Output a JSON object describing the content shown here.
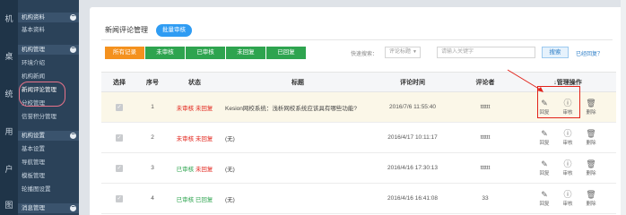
{
  "rail_icons": [
    "机",
    "桌",
    "统",
    "用",
    "户",
    "图"
  ],
  "menu": {
    "sections": [
      {
        "label": "机构资料",
        "items": [
          "基本资料"
        ]
      },
      {
        "label": "机构管理",
        "items": [
          "环境介绍",
          "机构新闻",
          "新闻评论管理",
          "分校管理",
          "信誉积分管理"
        ]
      },
      {
        "label": "机构设置",
        "items": [
          "基本设置",
          "导航管理",
          "模板管理",
          "轮播图设置"
        ]
      },
      {
        "label": "消息管理",
        "items": []
      }
    ],
    "toggle": "−"
  },
  "page": {
    "title": "新闻评论管理",
    "batch_button": "批量审核"
  },
  "filters": [
    "所有记录",
    "未审核",
    "已审核",
    "未回复",
    "已回复"
  ],
  "search": {
    "label": "快速搜索：",
    "select_value": "评论标题",
    "placeholder": "请输入关键字",
    "button": "搜索",
    "finish": "已经回复？"
  },
  "table": {
    "headers": [
      "选择",
      "序号",
      "状态",
      "标题",
      "评论时间",
      "评论者",
      "↓管理操作"
    ],
    "actions": {
      "reply": "回复",
      "audit": "审核",
      "delete": "删除"
    },
    "rows": [
      {
        "no": "1",
        "status1": "未审核",
        "status2": "未回复",
        "s1color": "red",
        "s2color": "red",
        "title": "Kesion网校系统：浅析网校系统应该具有哪些功能?",
        "time": "2016/7/6 11:55:40",
        "user": "tttttt"
      },
      {
        "no": "2",
        "status1": "未审核",
        "status2": "未回复",
        "s1color": "red",
        "s2color": "red",
        "title": "(无)",
        "time": "2016/4/17 10:11:17",
        "user": "tttttt"
      },
      {
        "no": "3",
        "status1": "已审核",
        "status2": "未回复",
        "s1color": "green",
        "s2color": "red",
        "title": "(无)",
        "time": "2016/4/16 17:30:13",
        "user": "tttttt"
      },
      {
        "no": "4",
        "status1": "已审核",
        "status2": "已回复",
        "s1color": "green",
        "s2color": "green",
        "title": "(无)",
        "time": "2016/4/16 16:41:08",
        "user": "33"
      }
    ]
  },
  "colors": {
    "active_tab": "#f4911e",
    "tab": "#2ea44f",
    "primary": "#2f9cf3",
    "red": "#e2231a",
    "green": "#2ea44f"
  }
}
